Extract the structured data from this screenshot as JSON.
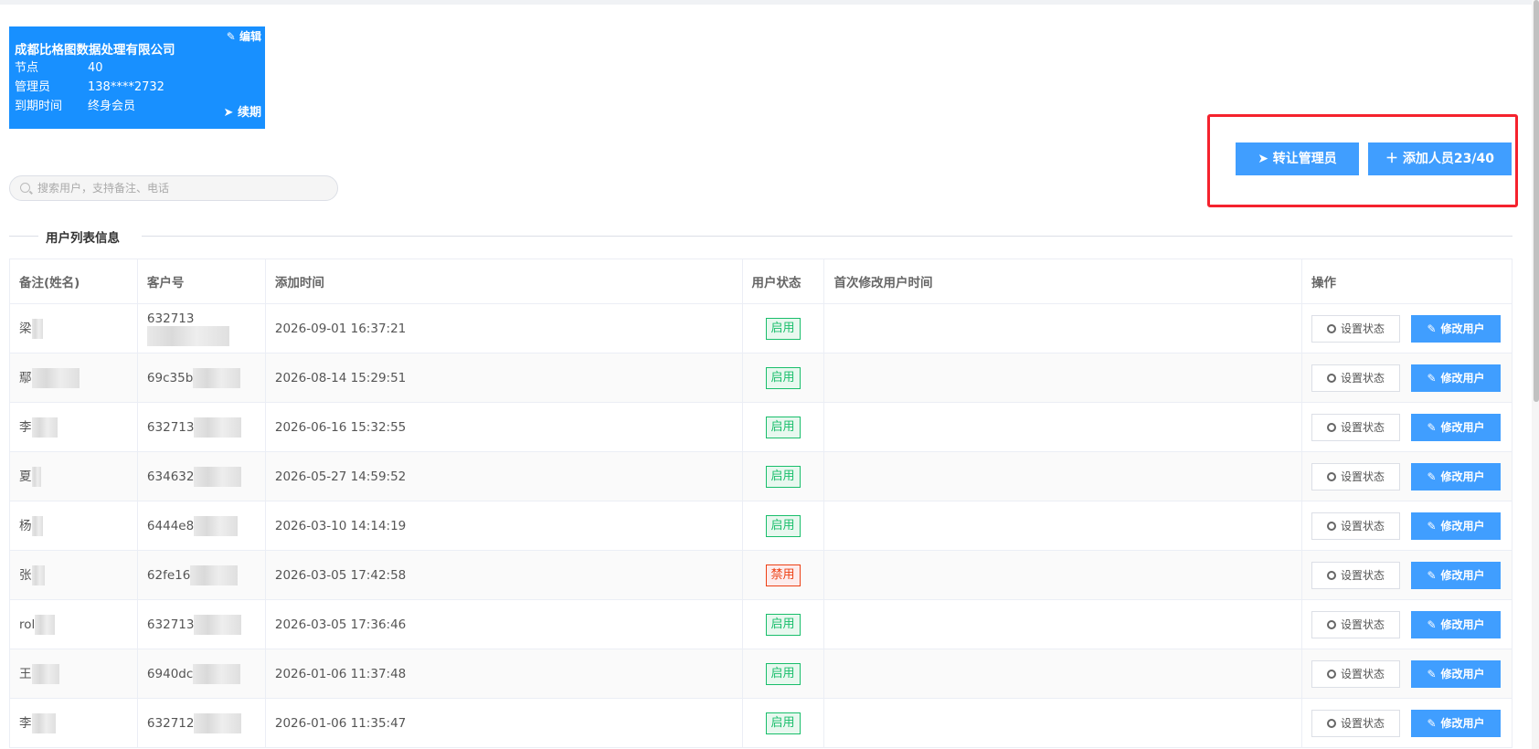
{
  "company_card": {
    "name": "成都比格图数据处理有限公司",
    "edit_label": "编辑",
    "nodes_label": "节点",
    "nodes_value": "40",
    "admin_label": "管理员",
    "admin_value": "138****2732",
    "expire_label": "到期时间",
    "expire_value": "终身会员",
    "renew_label": "续期"
  },
  "actions": {
    "transfer_admin": "转让管理员",
    "add_member": "添加人员23/40"
  },
  "search": {
    "placeholder": "搜索用户，支持备注、电话"
  },
  "section_title": "用户列表信息",
  "table": {
    "headers": [
      "备注(姓名)",
      "客户号",
      "添加时间",
      "用户状态",
      "首次修改用户时间",
      "操作"
    ],
    "set_status_label": "设置状态",
    "edit_user_label": "修改用户",
    "rows": [
      {
        "name": "梁",
        "customer": "632713",
        "added": "2026-09-01 16:37:21",
        "status": "启用",
        "status_type": "on",
        "first_modified": ""
      },
      {
        "name": "鄢",
        "customer": "69c35b",
        "added": "2026-08-14 15:29:51",
        "status": "启用",
        "status_type": "on",
        "first_modified": ""
      },
      {
        "name": "李",
        "customer": "632713",
        "added": "2026-06-16 15:32:55",
        "status": "启用",
        "status_type": "on",
        "first_modified": ""
      },
      {
        "name": "夏",
        "customer": "634632",
        "added": "2026-05-27 14:59:52",
        "status": "启用",
        "status_type": "on",
        "first_modified": ""
      },
      {
        "name": "杨",
        "customer": "6444e8",
        "added": "2026-03-10 14:14:19",
        "status": "启用",
        "status_type": "on",
        "first_modified": ""
      },
      {
        "name": "张",
        "customer": "62fe16",
        "added": "2026-03-05 17:42:58",
        "status": "禁用",
        "status_type": "off",
        "first_modified": ""
      },
      {
        "name": "rol",
        "customer": "632713",
        "added": "2026-03-05 17:36:46",
        "status": "启用",
        "status_type": "on",
        "first_modified": ""
      },
      {
        "name": "王",
        "customer": "6940dc",
        "added": "2026-01-06 11:37:48",
        "status": "启用",
        "status_type": "on",
        "first_modified": ""
      },
      {
        "name": "李",
        "customer": "632712",
        "added": "2026-01-06 11:35:47",
        "status": "启用",
        "status_type": "on",
        "first_modified": ""
      }
    ]
  },
  "colors": {
    "primary": "#409eff",
    "card_bg": "#1890ff",
    "highlight": "#f5222d",
    "enabled": "#19be6b",
    "disabled": "#ed4014"
  }
}
